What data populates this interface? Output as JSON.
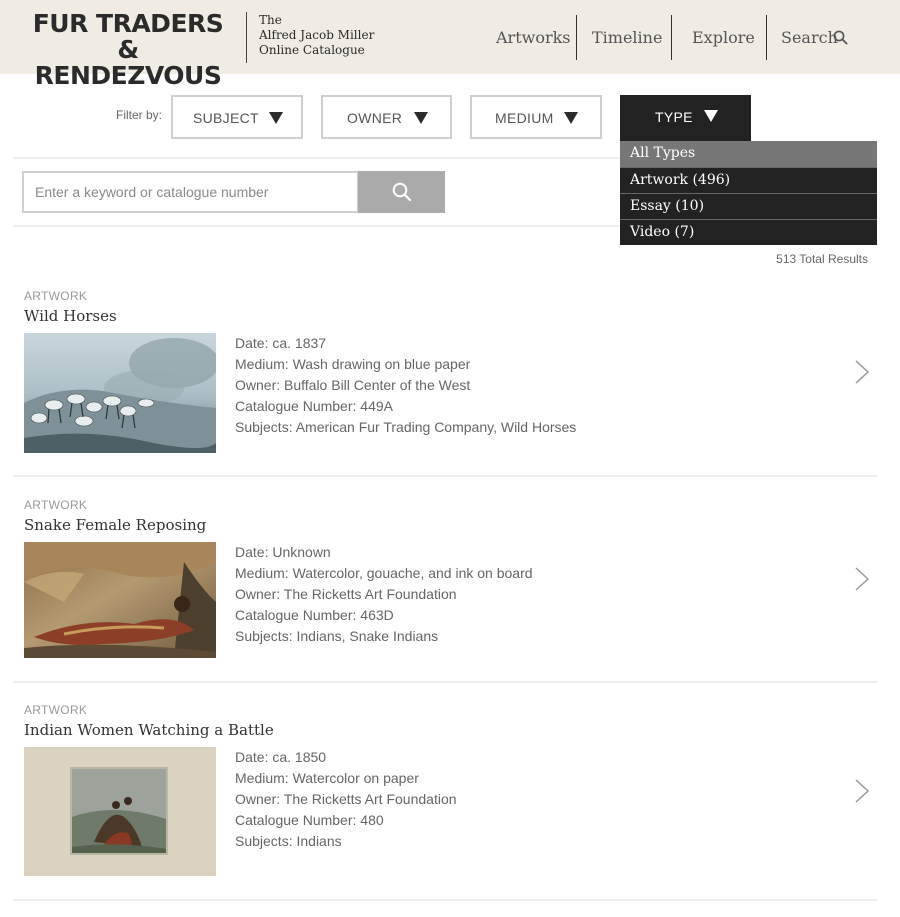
{
  "header": {
    "logo_line1": "FUR TRADERS &",
    "logo_line2": "RENDEZVOUS",
    "sub_line1": "The",
    "sub_line2": "Alfred Jacob Miller",
    "sub_line3": "Online Catalogue",
    "nav": {
      "artworks": "Artworks",
      "timeline": "Timeline",
      "explore": "Explore",
      "search": "Search"
    }
  },
  "filters": {
    "label": "Filter by:",
    "subject": "SUBJECT",
    "owner": "OWNER",
    "medium": "MEDIUM",
    "type": "TYPE"
  },
  "search": {
    "placeholder": "Enter a keyword or catalogue number"
  },
  "type_dropdown": {
    "selected": "All Types",
    "options": [
      "All Types",
      "Artwork (496)",
      "Essay (10)",
      "Video (7)"
    ]
  },
  "total_results": "513 Total Results",
  "results": [
    {
      "type": "ARTWORK",
      "title": "Wild Horses",
      "date": "Date: ca. 1837",
      "medium": "Medium: Wash drawing on blue paper",
      "owner": "Owner: Buffalo Bill Center of the West",
      "catalogue": "Catalogue Number: 449A",
      "subjects": "Subjects: American Fur Trading Company, Wild Horses"
    },
    {
      "type": "ARTWORK",
      "title": "Snake Female Reposing",
      "date": "Date: Unknown",
      "medium": "Medium: Watercolor, gouache, and ink on board",
      "owner": "Owner: The Ricketts Art Foundation",
      "catalogue": "Catalogue Number: 463D",
      "subjects": "Subjects: Indians, Snake Indians"
    },
    {
      "type": "ARTWORK",
      "title": "Indian Women Watching a Battle",
      "date": "Date: ca. 1850",
      "medium": "Medium: Watercolor on paper",
      "owner": "Owner: The Ricketts Art Foundation",
      "catalogue": "Catalogue Number: 480",
      "subjects": "Subjects: Indians"
    }
  ],
  "colors": {
    "header_bg": "#f0ebe3",
    "dropdown_bg": "#222222",
    "dropdown_active": "#777777",
    "search_button": "#aaaaaa"
  }
}
